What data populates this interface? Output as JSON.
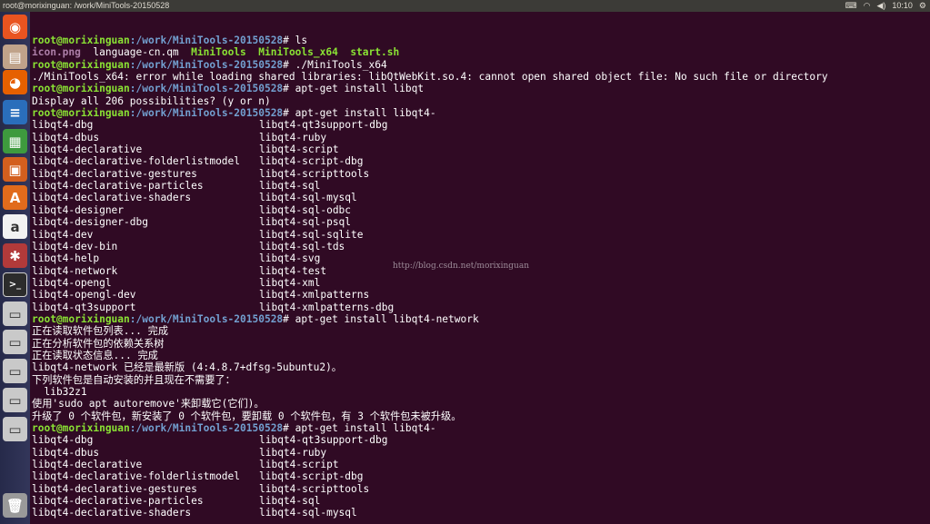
{
  "window_title": "root@morixinguan: /work/MiniTools-20150528",
  "clock": "10:10",
  "indicator_icons": [
    "keyboard-icon",
    "wifi-icon",
    "volume-icon"
  ],
  "launcher": [
    {
      "name": "dash-icon",
      "glyph": "◉",
      "bg": "#e95420"
    },
    {
      "name": "files-icon",
      "glyph": "▤",
      "bg": "#c0a38a"
    },
    {
      "name": "firefox-icon",
      "glyph": "◕",
      "bg": "#e66000"
    },
    {
      "name": "writer-icon",
      "glyph": "≡",
      "bg": "#2a6ebb"
    },
    {
      "name": "calc-icon",
      "glyph": "▦",
      "bg": "#3e9a3e"
    },
    {
      "name": "impress-icon",
      "glyph": "▣",
      "bg": "#d35f1e"
    },
    {
      "name": "software-center-icon",
      "glyph": "A",
      "bg": "#e16b1c"
    },
    {
      "name": "amazon-icon",
      "glyph": "a",
      "bg": "#f2f2f2"
    },
    {
      "name": "system-settings-icon",
      "glyph": "✱",
      "bg": "#b23a3a"
    },
    {
      "name": "terminal-icon",
      "glyph": ">_",
      "bg": "#2c2c2c"
    },
    {
      "name": "drive-icon",
      "glyph": "▭",
      "bg": "#c9c9c9"
    },
    {
      "name": "drive-icon",
      "glyph": "▭",
      "bg": "#c9c9c9"
    },
    {
      "name": "drive-icon",
      "glyph": "▭",
      "bg": "#c9c9c9"
    },
    {
      "name": "drive-icon",
      "glyph": "▭",
      "bg": "#c9c9c9"
    },
    {
      "name": "drive-icon",
      "glyph": "▭",
      "bg": "#c9c9c9"
    },
    {
      "name": "trash-icon",
      "glyph": "🗑",
      "bg": "#9a9a9a"
    }
  ],
  "prompt": {
    "user": "root@morixinguan",
    "path": ":/work/MiniTools-20150528",
    "symbol": "# "
  },
  "colors": {
    "background": "#300a24",
    "prompt_user": "#8ae234",
    "prompt_path": "#729fcf",
    "executable": "#8ae234",
    "text": "#ffffff"
  },
  "watermark": "http://blog.csdn.net/morixinguan",
  "terminal": {
    "cmd1": "ls",
    "ls_items": [
      {
        "text": "icon.png",
        "kind": "image"
      },
      {
        "text": "language-cn.qm",
        "kind": "plain"
      },
      {
        "text": "MiniTools",
        "kind": "exec"
      },
      {
        "text": "MiniTools_x64",
        "kind": "exec"
      },
      {
        "text": "start.sh",
        "kind": "exec"
      }
    ],
    "cmd2": "./MiniTools_x64",
    "error_line": "./MiniTools_x64: error while loading shared libraries: libQtWebKit.so.4: cannot open shared object file: No such file or directory",
    "cmd3": "apt-get install libqt",
    "display_all": "Display all 206 possibilities? (y or n)",
    "cmd4": "apt-get install libqt4-",
    "completions": [
      [
        "libqt4-dbg",
        "libqt4-qt3support-dbg"
      ],
      [
        "libqt4-dbus",
        "libqt4-ruby"
      ],
      [
        "libqt4-declarative",
        "libqt4-script"
      ],
      [
        "libqt4-declarative-folderlistmodel",
        "libqt4-script-dbg"
      ],
      [
        "libqt4-declarative-gestures",
        "libqt4-scripttools"
      ],
      [
        "libqt4-declarative-particles",
        "libqt4-sql"
      ],
      [
        "libqt4-declarative-shaders",
        "libqt4-sql-mysql"
      ],
      [
        "libqt4-designer",
        "libqt4-sql-odbc"
      ],
      [
        "libqt4-designer-dbg",
        "libqt4-sql-psql"
      ],
      [
        "libqt4-dev",
        "libqt4-sql-sqlite"
      ],
      [
        "libqt4-dev-bin",
        "libqt4-sql-tds"
      ],
      [
        "libqt4-help",
        "libqt4-svg"
      ],
      [
        "libqt4-network",
        "libqt4-test"
      ],
      [
        "libqt4-opengl",
        "libqt4-xml"
      ],
      [
        "libqt4-opengl-dev",
        "libqt4-xmlpatterns"
      ],
      [
        "libqt4-qt3support",
        "libqt4-xmlpatterns-dbg"
      ]
    ],
    "cmd5": "apt-get install libqt4-network",
    "apt_output": [
      "正在读取软件包列表... 完成",
      "正在分析软件包的依赖关系树",
      "正在读取状态信息... 完成",
      "libqt4-network 已经是最新版 (4:4.8.7+dfsg-5ubuntu2)。",
      "下列软件包是自动安装的并且现在不需要了：",
      "  lib32z1",
      "使用'sudo apt autoremove'来卸载它(它们)。",
      "升级了 0 个软件包，新安装了 0 个软件包，要卸载 0 个软件包，有 3 个软件包未被升级。"
    ],
    "cmd6": "apt-get install libqt4-",
    "completions2": [
      [
        "libqt4-dbg",
        "libqt4-qt3support-dbg"
      ],
      [
        "libqt4-dbus",
        "libqt4-ruby"
      ],
      [
        "libqt4-declarative",
        "libqt4-script"
      ],
      [
        "libqt4-declarative-folderlistmodel",
        "libqt4-script-dbg"
      ],
      [
        "libqt4-declarative-gestures",
        "libqt4-scripttools"
      ],
      [
        "libqt4-declarative-particles",
        "libqt4-sql"
      ],
      [
        "libqt4-declarative-shaders",
        "libqt4-sql-mysql"
      ]
    ]
  }
}
